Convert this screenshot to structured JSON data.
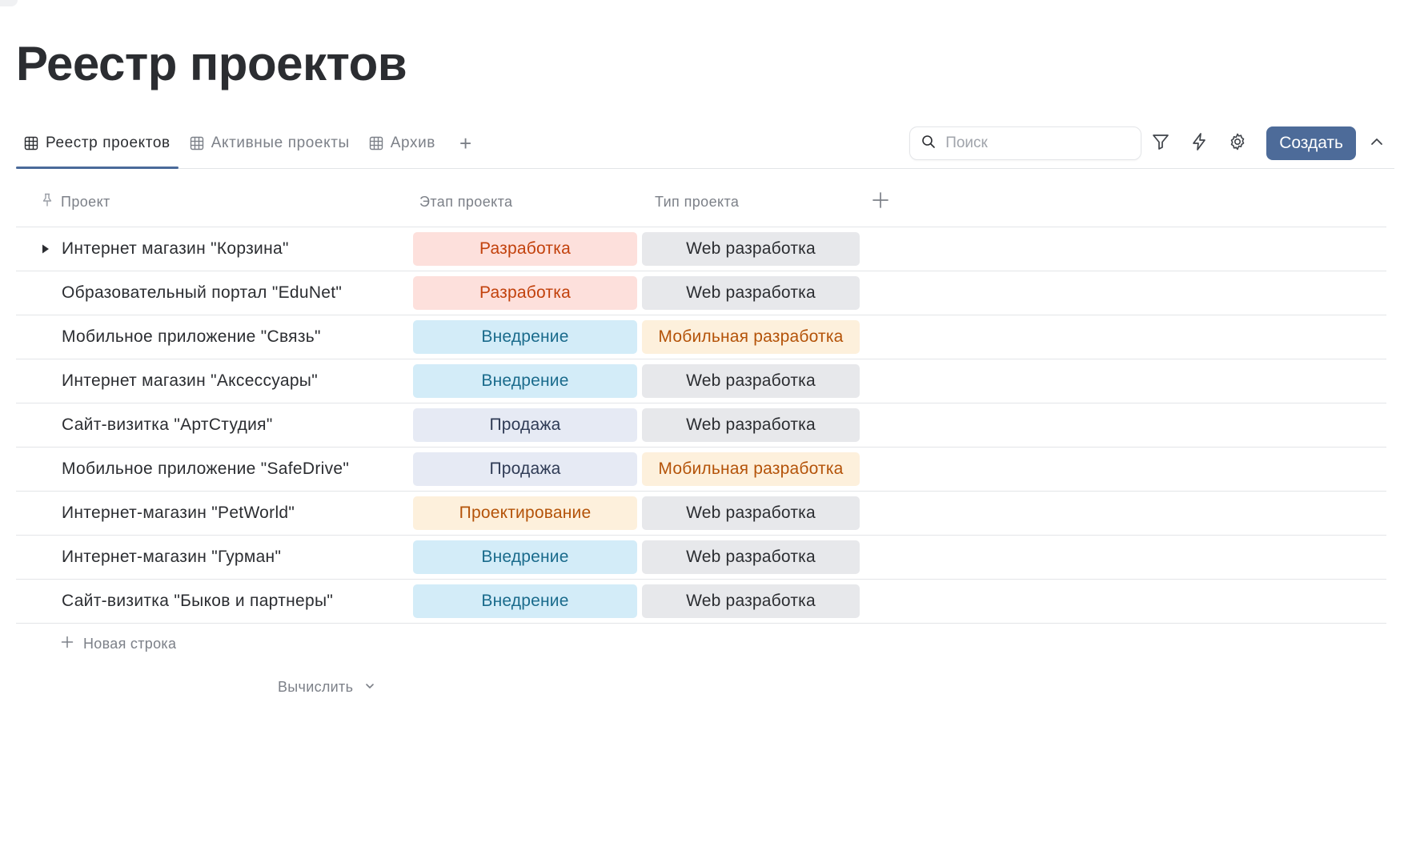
{
  "page": {
    "title": "Реестр проектов"
  },
  "tabs": [
    {
      "label": "Реестр проектов",
      "active": true,
      "icon": "table-icon"
    },
    {
      "label": "Активные проекты",
      "active": false,
      "icon": "table-icon"
    },
    {
      "label": "Архив",
      "active": false,
      "icon": "table-icon"
    }
  ],
  "toolbar": {
    "add_tab_label": "+",
    "search_placeholder": "Поиск",
    "search_value": "",
    "create_label": "Создать",
    "icons": [
      "search-icon",
      "filter-icon",
      "lightning-icon",
      "gear-icon",
      "chevron-up-icon"
    ]
  },
  "table": {
    "columns": {
      "project": "Проект",
      "stage": "Этап проекта",
      "type": "Тип проекта"
    },
    "rows": [
      {
        "project": "Интернет магазин \"Корзина\"",
        "stage": "Разработка",
        "type": "Web разработка",
        "expandable": true
      },
      {
        "project": "Образовательный портал \"EduNet\"",
        "stage": "Разработка",
        "type": "Web разработка",
        "expandable": false
      },
      {
        "project": "Мобильное приложение \"Связь\"",
        "stage": "Внедрение",
        "type": "Мобильная разработка",
        "expandable": false
      },
      {
        "project": "Интернет магазин \"Аксессуары\"",
        "stage": "Внедрение",
        "type": "Web разработка",
        "expandable": false
      },
      {
        "project": "Сайт-визитка \"АртСтудия\"",
        "stage": "Продажа",
        "type": "Web разработка",
        "expandable": false
      },
      {
        "project": "Мобильное приложение \"SafeDrive\"",
        "stage": "Продажа",
        "type": "Мобильная разработка",
        "expandable": false
      },
      {
        "project": "Интернет-магазин \"PetWorld\"",
        "stage": "Проектирование",
        "type": "Web разработка",
        "expandable": false
      },
      {
        "project": "Интернет-магазин \"Гурман\"",
        "stage": "Внедрение",
        "type": "Web разработка",
        "expandable": false
      },
      {
        "project": "Сайт-визитка \"Быков и партнеры\"",
        "stage": "Внедрение",
        "type": "Web разработка",
        "expandable": false
      }
    ],
    "new_row_label": "Новая строка",
    "calculate_label": "Вычислить"
  },
  "colors": {
    "accent": "#4d6b99",
    "stage": {
      "Разработка": {
        "bg": "#fde0dc",
        "fg": "#c2410c"
      },
      "Внедрение": {
        "bg": "#d3ecf8",
        "fg": "#1a6b8c"
      },
      "Продажа": {
        "bg": "#e6eaf4",
        "fg": "#2f3b55"
      },
      "Проектирование": {
        "bg": "#fdf0dc",
        "fg": "#b45309"
      }
    },
    "type": {
      "Web разработка": {
        "bg": "#e7e8eb",
        "fg": "#2b2d31"
      },
      "Мобильная разработка": {
        "bg": "#fdf0dc",
        "fg": "#b45309"
      }
    }
  }
}
